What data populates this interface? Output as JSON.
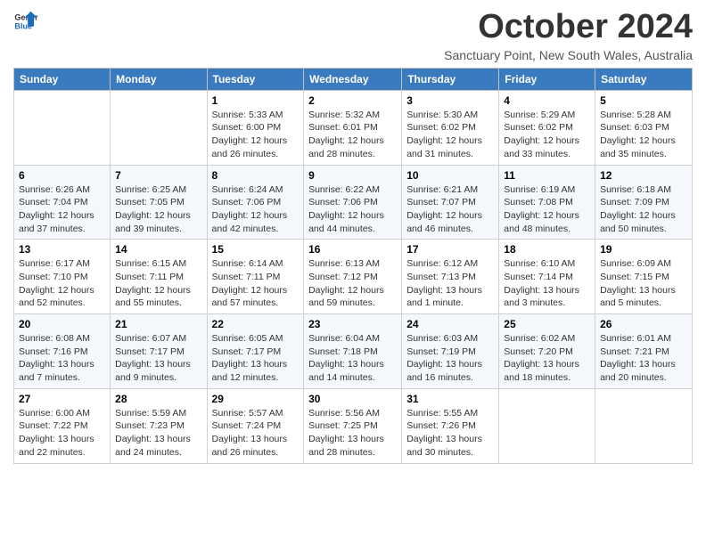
{
  "header": {
    "logo_general": "General",
    "logo_blue": "Blue",
    "month_title": "October 2024",
    "subtitle": "Sanctuary Point, New South Wales, Australia"
  },
  "days_of_week": [
    "Sunday",
    "Monday",
    "Tuesday",
    "Wednesday",
    "Thursday",
    "Friday",
    "Saturday"
  ],
  "weeks": [
    [
      {
        "day": "",
        "info": ""
      },
      {
        "day": "",
        "info": ""
      },
      {
        "day": "1",
        "info": "Sunrise: 5:33 AM\nSunset: 6:00 PM\nDaylight: 12 hours\nand 26 minutes."
      },
      {
        "day": "2",
        "info": "Sunrise: 5:32 AM\nSunset: 6:01 PM\nDaylight: 12 hours\nand 28 minutes."
      },
      {
        "day": "3",
        "info": "Sunrise: 5:30 AM\nSunset: 6:02 PM\nDaylight: 12 hours\nand 31 minutes."
      },
      {
        "day": "4",
        "info": "Sunrise: 5:29 AM\nSunset: 6:02 PM\nDaylight: 12 hours\nand 33 minutes."
      },
      {
        "day": "5",
        "info": "Sunrise: 5:28 AM\nSunset: 6:03 PM\nDaylight: 12 hours\nand 35 minutes."
      }
    ],
    [
      {
        "day": "6",
        "info": "Sunrise: 6:26 AM\nSunset: 7:04 PM\nDaylight: 12 hours\nand 37 minutes."
      },
      {
        "day": "7",
        "info": "Sunrise: 6:25 AM\nSunset: 7:05 PM\nDaylight: 12 hours\nand 39 minutes."
      },
      {
        "day": "8",
        "info": "Sunrise: 6:24 AM\nSunset: 7:06 PM\nDaylight: 12 hours\nand 42 minutes."
      },
      {
        "day": "9",
        "info": "Sunrise: 6:22 AM\nSunset: 7:06 PM\nDaylight: 12 hours\nand 44 minutes."
      },
      {
        "day": "10",
        "info": "Sunrise: 6:21 AM\nSunset: 7:07 PM\nDaylight: 12 hours\nand 46 minutes."
      },
      {
        "day": "11",
        "info": "Sunrise: 6:19 AM\nSunset: 7:08 PM\nDaylight: 12 hours\nand 48 minutes."
      },
      {
        "day": "12",
        "info": "Sunrise: 6:18 AM\nSunset: 7:09 PM\nDaylight: 12 hours\nand 50 minutes."
      }
    ],
    [
      {
        "day": "13",
        "info": "Sunrise: 6:17 AM\nSunset: 7:10 PM\nDaylight: 12 hours\nand 52 minutes."
      },
      {
        "day": "14",
        "info": "Sunrise: 6:15 AM\nSunset: 7:11 PM\nDaylight: 12 hours\nand 55 minutes."
      },
      {
        "day": "15",
        "info": "Sunrise: 6:14 AM\nSunset: 7:11 PM\nDaylight: 12 hours\nand 57 minutes."
      },
      {
        "day": "16",
        "info": "Sunrise: 6:13 AM\nSunset: 7:12 PM\nDaylight: 12 hours\nand 59 minutes."
      },
      {
        "day": "17",
        "info": "Sunrise: 6:12 AM\nSunset: 7:13 PM\nDaylight: 13 hours\nand 1 minute."
      },
      {
        "day": "18",
        "info": "Sunrise: 6:10 AM\nSunset: 7:14 PM\nDaylight: 13 hours\nand 3 minutes."
      },
      {
        "day": "19",
        "info": "Sunrise: 6:09 AM\nSunset: 7:15 PM\nDaylight: 13 hours\nand 5 minutes."
      }
    ],
    [
      {
        "day": "20",
        "info": "Sunrise: 6:08 AM\nSunset: 7:16 PM\nDaylight: 13 hours\nand 7 minutes."
      },
      {
        "day": "21",
        "info": "Sunrise: 6:07 AM\nSunset: 7:17 PM\nDaylight: 13 hours\nand 9 minutes."
      },
      {
        "day": "22",
        "info": "Sunrise: 6:05 AM\nSunset: 7:17 PM\nDaylight: 13 hours\nand 12 minutes."
      },
      {
        "day": "23",
        "info": "Sunrise: 6:04 AM\nSunset: 7:18 PM\nDaylight: 13 hours\nand 14 minutes."
      },
      {
        "day": "24",
        "info": "Sunrise: 6:03 AM\nSunset: 7:19 PM\nDaylight: 13 hours\nand 16 minutes."
      },
      {
        "day": "25",
        "info": "Sunrise: 6:02 AM\nSunset: 7:20 PM\nDaylight: 13 hours\nand 18 minutes."
      },
      {
        "day": "26",
        "info": "Sunrise: 6:01 AM\nSunset: 7:21 PM\nDaylight: 13 hours\nand 20 minutes."
      }
    ],
    [
      {
        "day": "27",
        "info": "Sunrise: 6:00 AM\nSunset: 7:22 PM\nDaylight: 13 hours\nand 22 minutes."
      },
      {
        "day": "28",
        "info": "Sunrise: 5:59 AM\nSunset: 7:23 PM\nDaylight: 13 hours\nand 24 minutes."
      },
      {
        "day": "29",
        "info": "Sunrise: 5:57 AM\nSunset: 7:24 PM\nDaylight: 13 hours\nand 26 minutes."
      },
      {
        "day": "30",
        "info": "Sunrise: 5:56 AM\nSunset: 7:25 PM\nDaylight: 13 hours\nand 28 minutes."
      },
      {
        "day": "31",
        "info": "Sunrise: 5:55 AM\nSunset: 7:26 PM\nDaylight: 13 hours\nand 30 minutes."
      },
      {
        "day": "",
        "info": ""
      },
      {
        "day": "",
        "info": ""
      }
    ]
  ]
}
